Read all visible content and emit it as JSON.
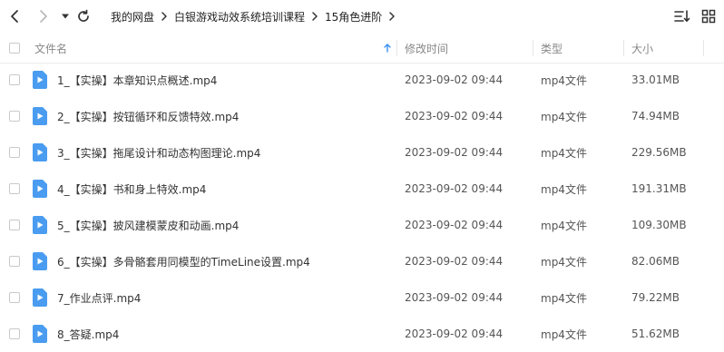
{
  "nav": {
    "breadcrumb": [
      "我的网盘",
      "白银游戏动效系统培训课程",
      "15角色进阶"
    ]
  },
  "columns": {
    "name": "文件名",
    "modified": "修改时间",
    "type": "类型",
    "size": "大小"
  },
  "files": [
    {
      "name": "1_【实操】本章知识点概述.mp4",
      "modified": "2023-09-02 09:44",
      "type": "mp4文件",
      "size": "33.01MB"
    },
    {
      "name": "2_【实操】按钮循环和反馈特效.mp4",
      "modified": "2023-09-02 09:44",
      "type": "mp4文件",
      "size": "74.94MB"
    },
    {
      "name": "3_【实操】拖尾设计和动态构图理论.mp4",
      "modified": "2023-09-02 09:44",
      "type": "mp4文件",
      "size": "229.56MB"
    },
    {
      "name": "4_【实操】书和身上特效.mp4",
      "modified": "2023-09-02 09:44",
      "type": "mp4文件",
      "size": "191.31MB"
    },
    {
      "name": "5_【实操】披风建模蒙皮和动画.mp4",
      "modified": "2023-09-02 09:44",
      "type": "mp4文件",
      "size": "109.30MB"
    },
    {
      "name": "6_【实操】多骨骼套用同模型的TimeLine设置.mp4",
      "modified": "2023-09-02 09:44",
      "type": "mp4文件",
      "size": "82.06MB"
    },
    {
      "name": "7_作业点评.mp4",
      "modified": "2023-09-02 09:44",
      "type": "mp4文件",
      "size": "79.22MB"
    },
    {
      "name": "8_答疑.mp4",
      "modified": "2023-09-02 09:44",
      "type": "mp4文件",
      "size": "51.62MB"
    }
  ],
  "icons": {
    "back": "chevron-left-icon",
    "forward": "chevron-right-icon",
    "history": "caret-down-icon",
    "refresh": "refresh-icon",
    "sort": "sort-list-icon",
    "grid": "grid-view-icon",
    "file": "video-file-icon",
    "sort_dir": "sort-ascending-arrow-icon"
  },
  "colors": {
    "accent": "#3b8ff4",
    "file_icon": "#4a9cf0",
    "border": "#ececec"
  }
}
